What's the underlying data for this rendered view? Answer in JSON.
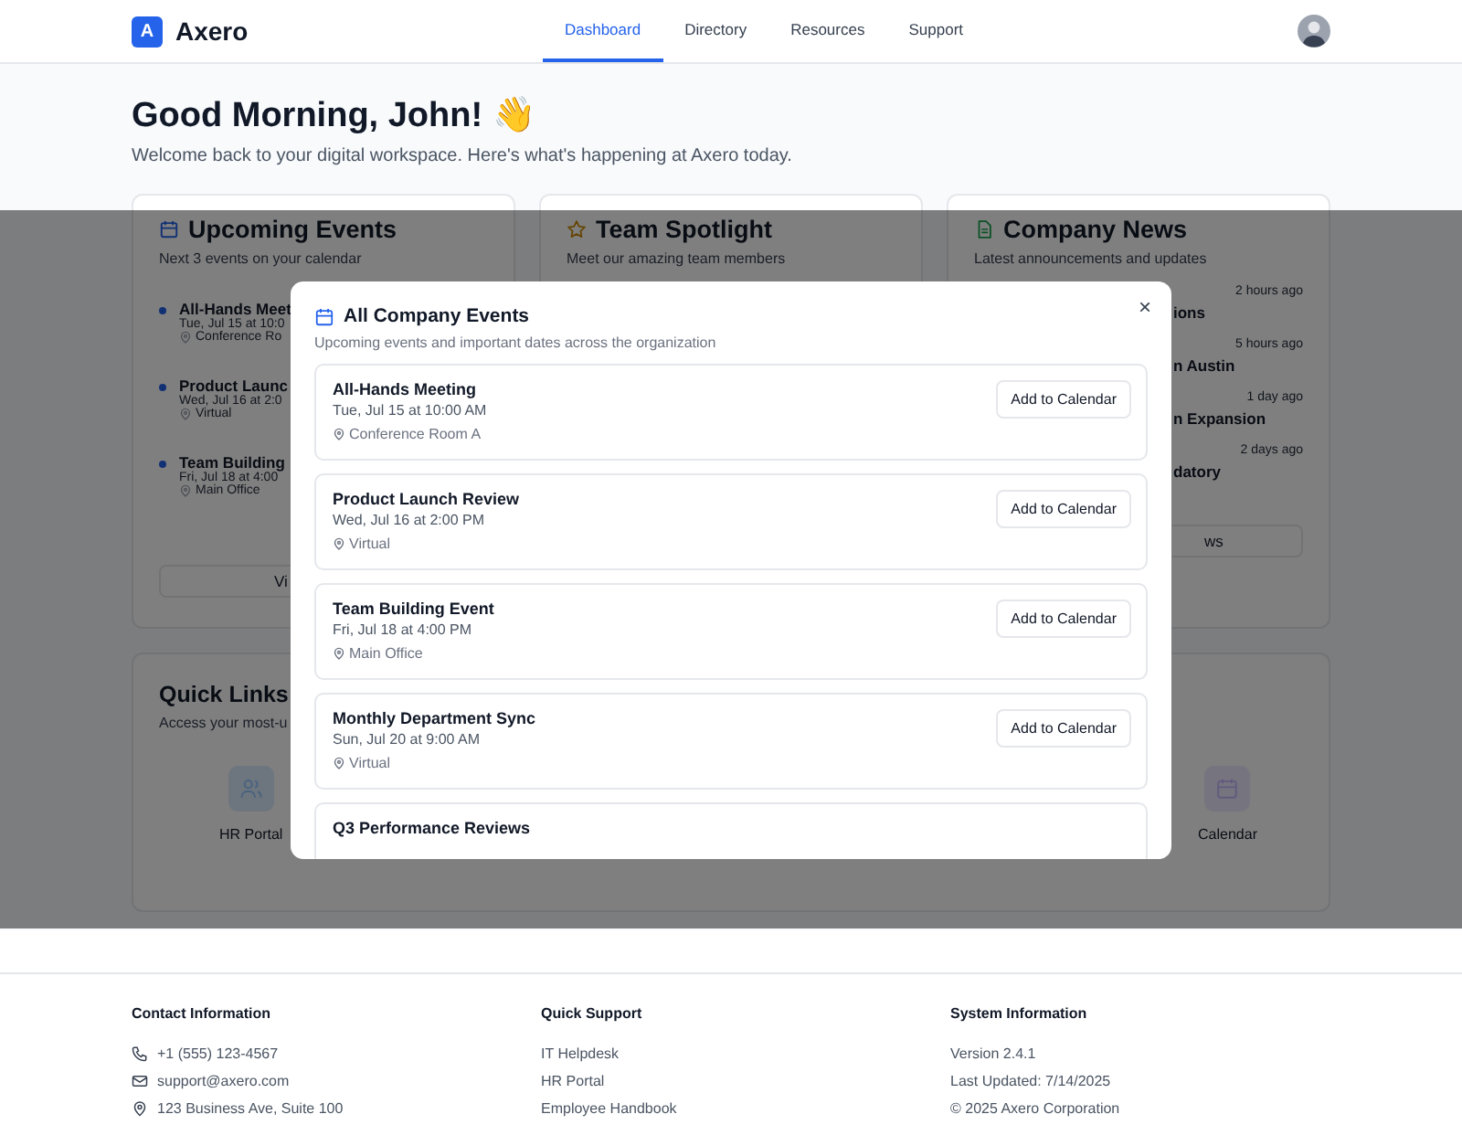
{
  "header": {
    "logo_letter": "A",
    "brand": "Axero",
    "nav": [
      {
        "label": "Dashboard",
        "selected": true
      },
      {
        "label": "Directory",
        "selected": false
      },
      {
        "label": "Resources",
        "selected": false
      },
      {
        "label": "Support",
        "selected": false
      }
    ]
  },
  "hero": {
    "title": "Good Morning, John! 👋",
    "subtitle": "Welcome back to your digital workspace. Here's what's happening at Axero today."
  },
  "events_card": {
    "title": "Upcoming Events",
    "subtitle": "Next 3 events on your calendar",
    "events": [
      {
        "title": "All-Hands Meet",
        "time": "Tue, Jul 15 at 10:0",
        "location": "Conference Ro"
      },
      {
        "title": "Product Launc",
        "time": "Wed, Jul 16 at 2:0",
        "location": "Virtual"
      },
      {
        "title": "Team Building",
        "time": "Fri, Jul 18 at 4:00",
        "location": "Main Office"
      }
    ],
    "button": "Vi"
  },
  "spotlight_card": {
    "title": "Team Spotlight",
    "subtitle": "Meet our amazing team members"
  },
  "news_card": {
    "title": "Company News",
    "subtitle": "Latest announcements and updates",
    "items": [
      {
        "title": "ions",
        "time": "2 hours ago"
      },
      {
        "title": "n Austin",
        "time": "5 hours ago"
      },
      {
        "title": "n Expansion",
        "time": "1 day ago"
      },
      {
        "title": "datory",
        "time": "2 days ago"
      }
    ],
    "button": "ws"
  },
  "quick_links": {
    "title": "Quick Links",
    "subtitle": "Access your most-u",
    "links": [
      {
        "label": "HR Portal",
        "kind": "people"
      },
      {
        "label": "Calendar",
        "kind": "calendar"
      }
    ]
  },
  "modal": {
    "title": "All Company Events",
    "subtitle": "Upcoming events and important dates across the organization",
    "close": "×",
    "events": [
      {
        "title": "All-Hands Meeting",
        "time": "Tue, Jul 15 at 10:00 AM",
        "location": "Conference Room A",
        "button": "Add to Calendar"
      },
      {
        "title": "Product Launch Review",
        "time": "Wed, Jul 16 at 2:00 PM",
        "location": "Virtual",
        "button": "Add to Calendar"
      },
      {
        "title": "Team Building Event",
        "time": "Fri, Jul 18 at 4:00 PM",
        "location": "Main Office",
        "button": "Add to Calendar"
      },
      {
        "title": "Monthly Department Sync",
        "time": "Sun, Jul 20 at 9:00 AM",
        "location": "Virtual",
        "button": "Add to Calendar"
      },
      {
        "title": "Q3 Performance Reviews"
      }
    ]
  },
  "footer": {
    "columns": [
      {
        "heading": "Contact Information",
        "items": [
          {
            "text": "+1 (555) 123-4567",
            "kind": "phone"
          },
          {
            "text": "support@axero.com",
            "kind": "email"
          },
          {
            "text": "123 Business Ave, Suite 100",
            "kind": "location"
          }
        ]
      },
      {
        "heading": "Quick Support",
        "items": [
          {
            "text": "IT Helpdesk",
            "kind": "link"
          },
          {
            "text": "HR Portal",
            "kind": "link"
          },
          {
            "text": "Employee Handbook",
            "kind": "link"
          }
        ]
      },
      {
        "heading": "System Information",
        "items": [
          {
            "text": "Version 2.4.1",
            "kind": "plain"
          },
          {
            "text": "Last Updated: 7/14/2025",
            "kind": "plain"
          },
          {
            "text": "© 2025 Axero Corporation",
            "kind": "plain"
          }
        ]
      }
    ]
  }
}
